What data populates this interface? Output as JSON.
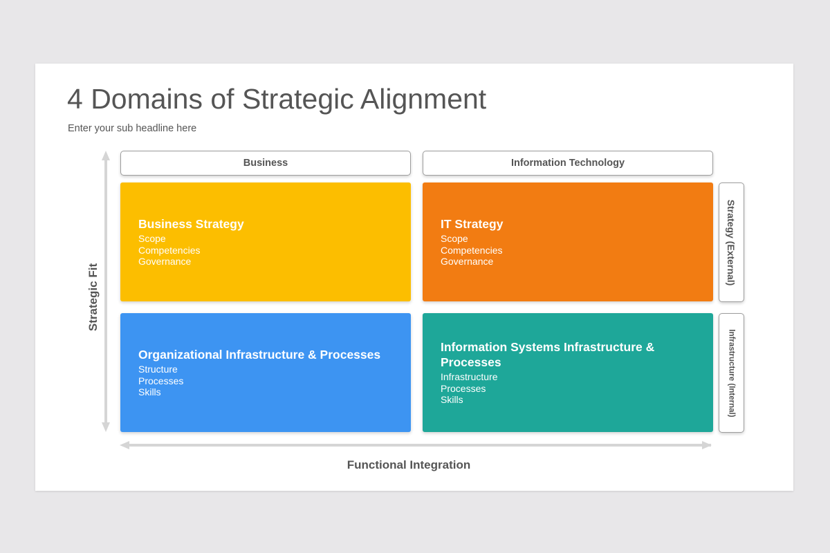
{
  "title": "4 Domains of Strategic Alignment",
  "subtitle": "Enter your sub headline here",
  "columns": {
    "business": "Business",
    "it": "Information Technology"
  },
  "rows": {
    "strategy": "Strategy (External)",
    "infrastructure": "Infrastructure (Internal)"
  },
  "axes": {
    "y_label": "Strategic Fit",
    "x_label": "Functional Integration"
  },
  "domains": [
    {
      "title": "Business Strategy",
      "items": [
        "Scope",
        "Competencies",
        "Governance"
      ],
      "color": "#fcbe00"
    },
    {
      "title": "IT Strategy",
      "items": [
        "Scope",
        "Competencies",
        "Governance"
      ],
      "color": "#f27c12"
    },
    {
      "title": "Organizational Infrastructure & Processes",
      "items": [
        "Structure",
        "Processes",
        "Skills"
      ],
      "color": "#3d94f2"
    },
    {
      "title": "Information Systems Infrastructure & Processes",
      "items": [
        "Infrastructure",
        "Processes",
        "Skills"
      ],
      "color": "#1ea799"
    }
  ],
  "colors": {
    "background": "#e8e7e9",
    "text": "#555555",
    "axis_arrow": "#d5d5d5"
  }
}
